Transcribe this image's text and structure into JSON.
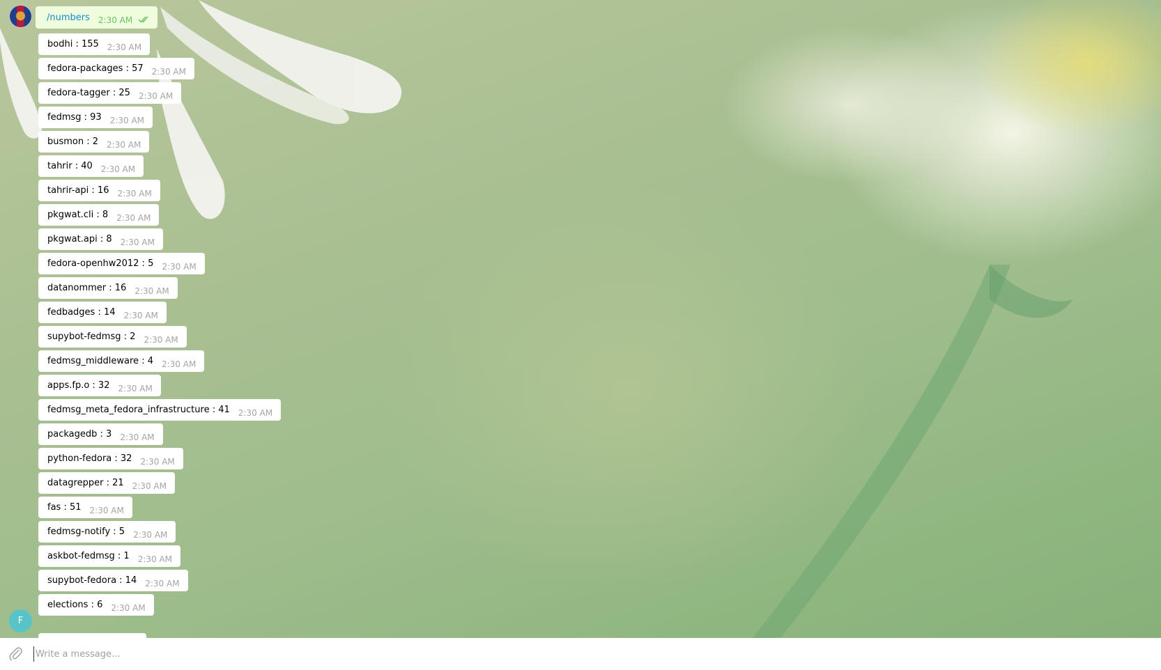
{
  "outgoing": {
    "command": "/numbers",
    "time": "2:30 AM",
    "status_icon": "double-check-icon"
  },
  "messages": [
    {
      "text": "bodhi : 155",
      "time": "2:30 AM"
    },
    {
      "text": "fedora-packages : 57",
      "time": "2:30 AM"
    },
    {
      "text": "fedora-tagger : 25",
      "time": "2:30 AM"
    },
    {
      "text": "fedmsg : 93",
      "time": "2:30 AM"
    },
    {
      "text": "busmon : 2",
      "time": "2:30 AM"
    },
    {
      "text": "tahrir : 40",
      "time": "2:30 AM"
    },
    {
      "text": "tahrir-api : 16",
      "time": "2:30 AM"
    },
    {
      "text": "pkgwat.cli : 8",
      "time": "2:30 AM"
    },
    {
      "text": "pkgwat.api : 8",
      "time": "2:30 AM"
    },
    {
      "text": "fedora-openhw2012 : 5",
      "time": "2:30 AM"
    },
    {
      "text": "datanommer : 16",
      "time": "2:30 AM"
    },
    {
      "text": "fedbadges : 14",
      "time": "2:30 AM"
    },
    {
      "text": "supybot-fedmsg : 2",
      "time": "2:30 AM"
    },
    {
      "text": "fedmsg_middleware : 4",
      "time": "2:30 AM"
    },
    {
      "text": "apps.fp.o : 32",
      "time": "2:30 AM"
    },
    {
      "text": "fedmsg_meta_fedora_infrastructure : 41",
      "time": "2:30 AM"
    },
    {
      "text": "packagedb : 3",
      "time": "2:30 AM"
    },
    {
      "text": "python-fedora : 32",
      "time": "2:30 AM"
    },
    {
      "text": "datagrepper : 21",
      "time": "2:30 AM"
    },
    {
      "text": "fas : 51",
      "time": "2:30 AM"
    },
    {
      "text": "fedmsg-notify : 5",
      "time": "2:30 AM"
    },
    {
      "text": "askbot-fedmsg : 1",
      "time": "2:30 AM"
    },
    {
      "text": "supybot-fedora : 14",
      "time": "2:30 AM"
    },
    {
      "text": "elections : 6",
      "time": "2:30 AM"
    }
  ],
  "bot_avatar": {
    "initial": "F",
    "color": "#58c4c8"
  },
  "composer": {
    "placeholder": "Write a message...",
    "attach_icon": "paperclip-icon"
  },
  "colors": {
    "incoming_bubble": "#ffffff",
    "outgoing_bubble": "#effdde",
    "command_link": "#168acd",
    "outgoing_time": "#6dc264",
    "incoming_time": "#a4a4a4"
  }
}
